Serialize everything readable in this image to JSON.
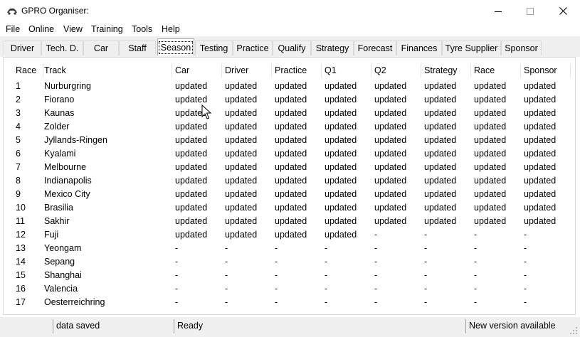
{
  "window": {
    "title": "GPRO Organiser:"
  },
  "menu": [
    "File",
    "Online",
    "View",
    "Training",
    "Tools",
    "Help"
  ],
  "tabs": [
    "Driver",
    "Tech. D.",
    "Car",
    "Staff",
    "Season",
    "Testing",
    "Practice",
    "Qualify",
    "Strategy",
    "Forecast",
    "Finances",
    "Tyre Supplier",
    "Sponsor"
  ],
  "active_tab": "Season",
  "table": {
    "columns": [
      "Race",
      "Track",
      "Car",
      "Driver",
      "Practice",
      "Q1",
      "Q2",
      "Strategy",
      "Race",
      "Sponsor"
    ],
    "rows": [
      [
        "1",
        "Nurburgring",
        "updated",
        "updated",
        "updated",
        "updated",
        "updated",
        "updated",
        "updated",
        "updated"
      ],
      [
        "2",
        "Fiorano",
        "updated",
        "updated",
        "updated",
        "updated",
        "updated",
        "updated",
        "updated",
        "updated"
      ],
      [
        "3",
        "Kaunas",
        "updated",
        "updated",
        "updated",
        "updated",
        "updated",
        "updated",
        "updated",
        "updated"
      ],
      [
        "4",
        "Zolder",
        "updated",
        "updated",
        "updated",
        "updated",
        "updated",
        "updated",
        "updated",
        "updated"
      ],
      [
        "5",
        "Jyllands-Ringen",
        "updated",
        "updated",
        "updated",
        "updated",
        "updated",
        "updated",
        "updated",
        "updated"
      ],
      [
        "6",
        "Kyalami",
        "updated",
        "updated",
        "updated",
        "updated",
        "updated",
        "updated",
        "updated",
        "updated"
      ],
      [
        "7",
        "Melbourne",
        "updated",
        "updated",
        "updated",
        "updated",
        "updated",
        "updated",
        "updated",
        "updated"
      ],
      [
        "8",
        "Indianapolis",
        "updated",
        "updated",
        "updated",
        "updated",
        "updated",
        "updated",
        "updated",
        "updated"
      ],
      [
        "9",
        "Mexico City",
        "updated",
        "updated",
        "updated",
        "updated",
        "updated",
        "updated",
        "updated",
        "updated"
      ],
      [
        "10",
        "Brasilia",
        "updated",
        "updated",
        "updated",
        "updated",
        "updated",
        "updated",
        "updated",
        "updated"
      ],
      [
        "11",
        "Sakhir",
        "updated",
        "updated",
        "updated",
        "updated",
        "updated",
        "updated",
        "updated",
        "updated"
      ],
      [
        "12",
        "Fuji",
        "updated",
        "updated",
        "updated",
        "updated",
        "-",
        "-",
        "-",
        "-"
      ],
      [
        "13",
        "Yeongam",
        "-",
        "-",
        "-",
        "-",
        "-",
        "-",
        "-",
        "-"
      ],
      [
        "14",
        "Sepang",
        "-",
        "-",
        "-",
        "-",
        "-",
        "-",
        "-",
        "-"
      ],
      [
        "15",
        "Shanghai",
        "-",
        "-",
        "-",
        "-",
        "-",
        "-",
        "-",
        "-"
      ],
      [
        "16",
        "Valencia",
        "-",
        "-",
        "-",
        "-",
        "-",
        "-",
        "-",
        "-"
      ],
      [
        "17",
        "Oesterreichring",
        "-",
        "-",
        "-",
        "-",
        "-",
        "-",
        "-",
        "-"
      ]
    ]
  },
  "status": {
    "left": "data saved",
    "middle": "Ready",
    "right": "New version available"
  }
}
